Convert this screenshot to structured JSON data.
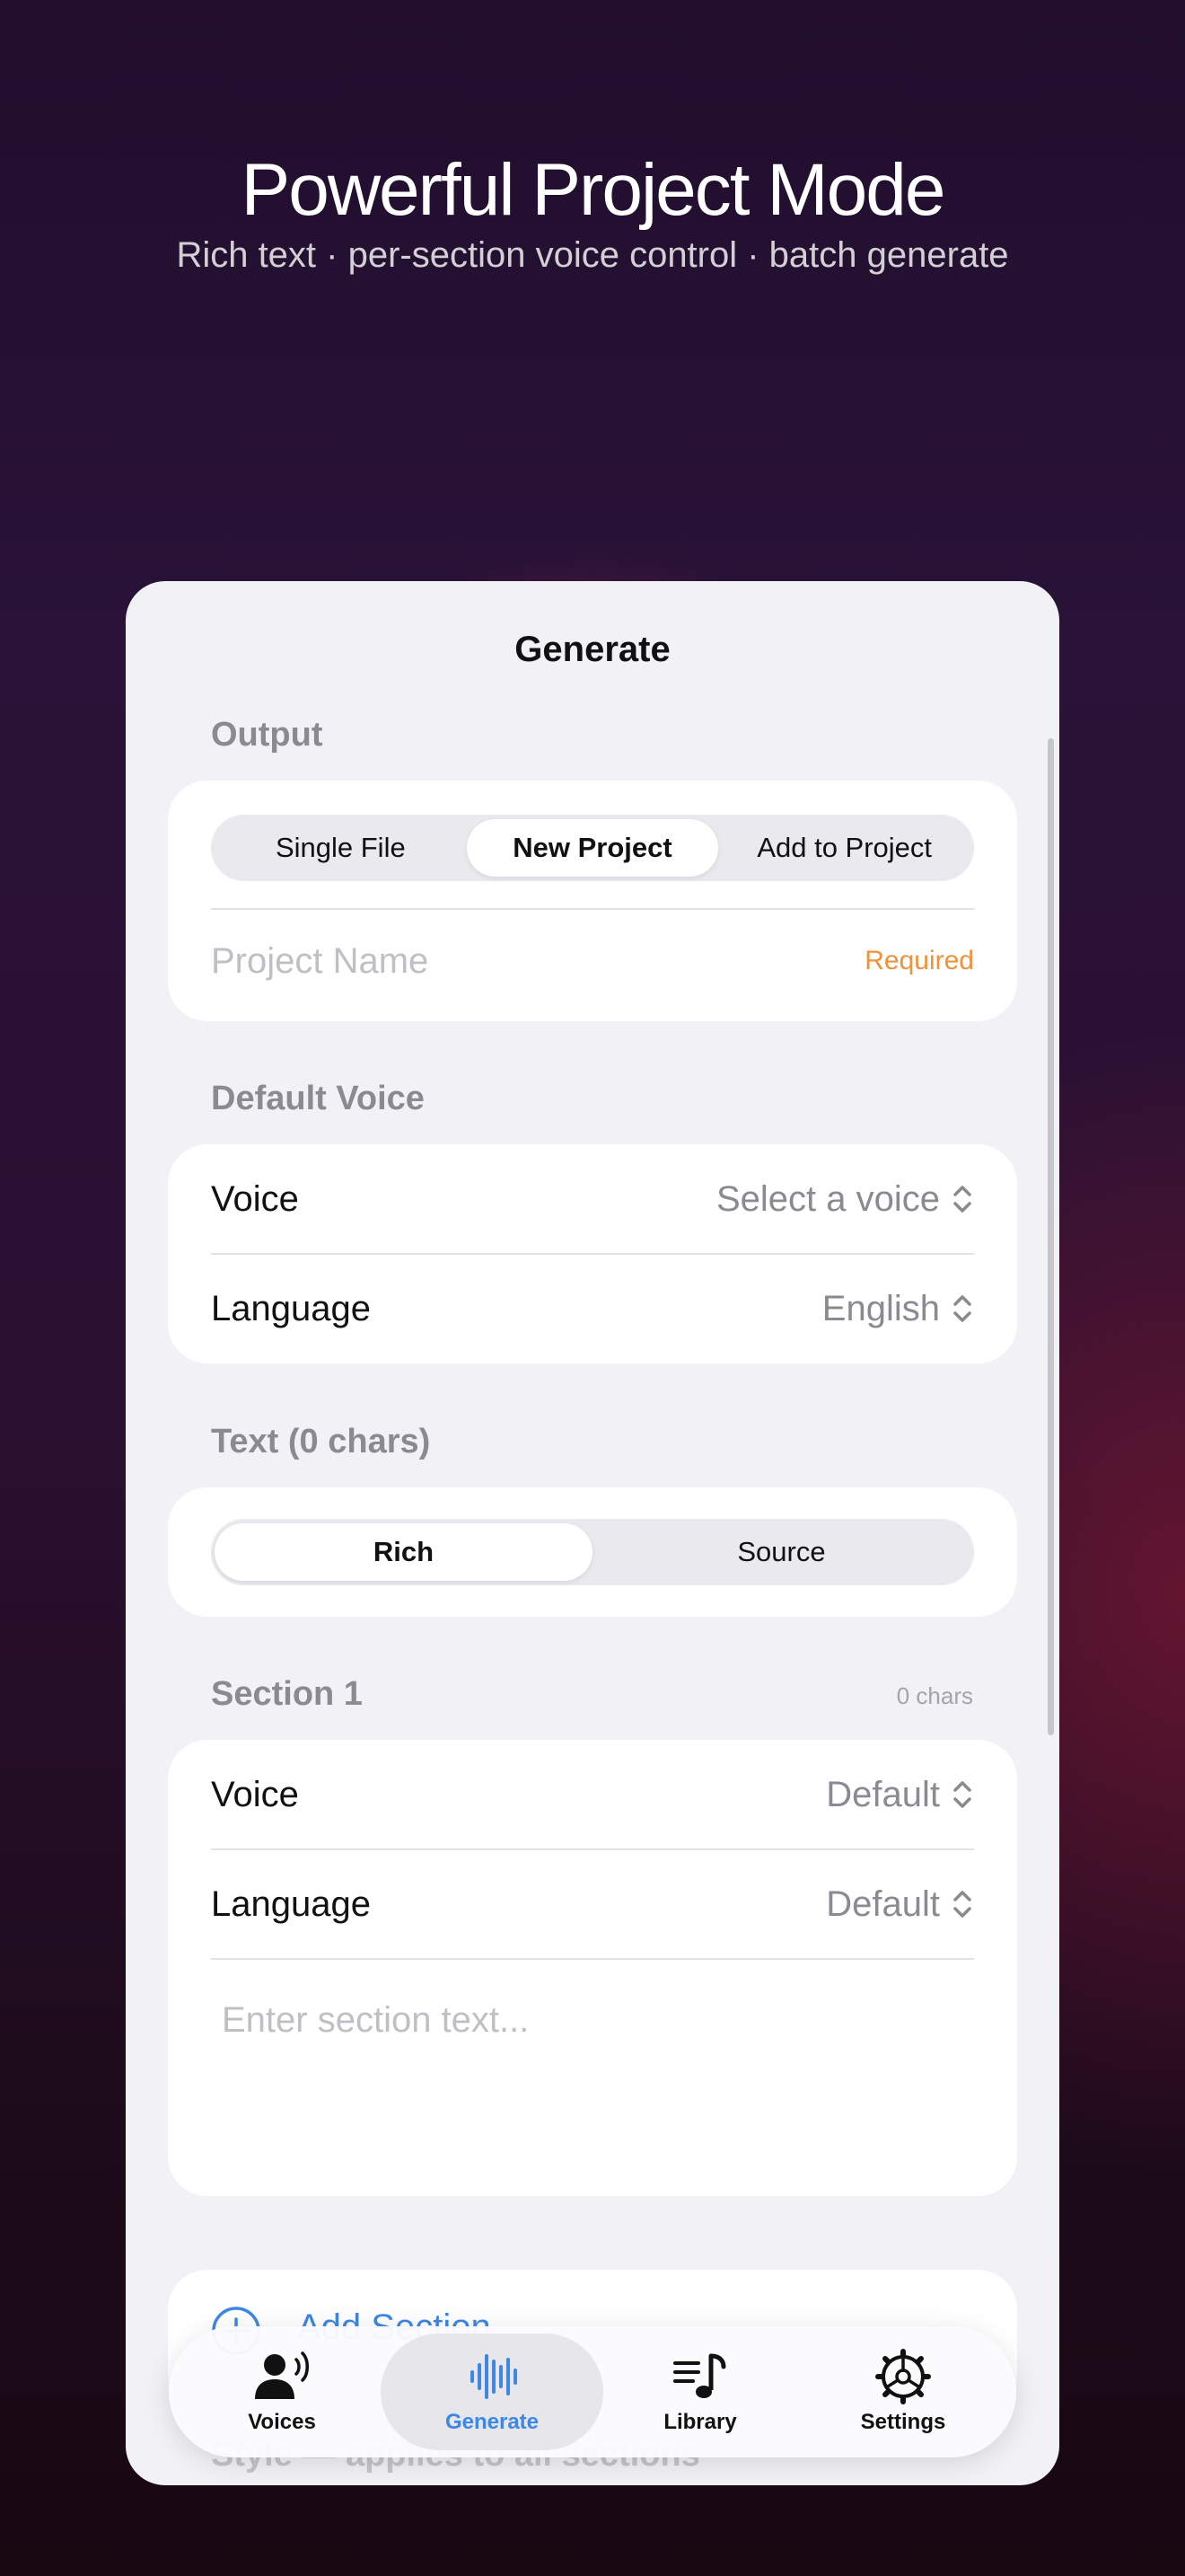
{
  "hero": {
    "title": "Powerful Project Mode",
    "subtitle": "Rich text · per-section voice control · batch generate"
  },
  "sheet": {
    "title": "Generate",
    "output": {
      "label": "Output",
      "modes": [
        "Single File",
        "New Project",
        "Add to Project"
      ],
      "selected_mode": "New Project",
      "project_name_placeholder": "Project Name",
      "required_label": "Required"
    },
    "default_voice": {
      "label": "Default Voice",
      "voice_label": "Voice",
      "voice_value": "Select a voice",
      "language_label": "Language",
      "language_value": "English"
    },
    "text": {
      "label": "Text (0 chars)",
      "modes": [
        "Rich",
        "Source"
      ],
      "selected_mode": "Rich"
    },
    "section": {
      "label": "Section 1",
      "count": "0 chars",
      "voice_label": "Voice",
      "voice_value": "Default",
      "language_label": "Language",
      "language_value": "Default",
      "text_placeholder": "Enter section text..."
    },
    "add_section_label": "Add Section",
    "style_label": "Style — applies to all sections"
  },
  "tabbar": {
    "items": [
      {
        "label": "Voices",
        "icon": "person-speaking-icon"
      },
      {
        "label": "Generate",
        "icon": "waveform-icon"
      },
      {
        "label": "Library",
        "icon": "music-list-icon"
      },
      {
        "label": "Settings",
        "icon": "gear-icon"
      }
    ],
    "selected": "Generate",
    "accent_color": "#3e87e4"
  }
}
